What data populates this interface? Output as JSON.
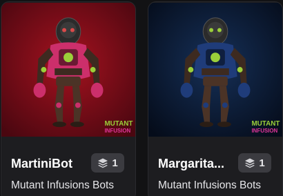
{
  "cards": [
    {
      "name": "MartiniBot",
      "collection": "Mutant Infusions Bots",
      "edition_count": "1",
      "badge_line1": "MUTANT",
      "badge_line2": "INFUSION",
      "icon": "layers-icon",
      "colors": {
        "bg": "#7a0b17",
        "body": "#cc2f6b",
        "accent": "#9bcf3a"
      }
    },
    {
      "name": "Margarita...",
      "collection": "Mutant Infusions Bots",
      "edition_count": "1",
      "badge_line1": "MUTANT",
      "badge_line2": "INFUSION",
      "icon": "layers-icon",
      "colors": {
        "bg": "#0a1a33",
        "body": "#1f3c7a",
        "accent": "#9bcf3a"
      }
    }
  ]
}
